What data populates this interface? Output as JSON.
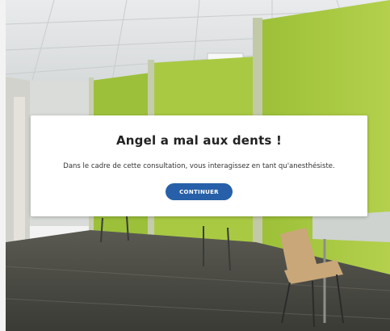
{
  "modal": {
    "title": "Angel a mal aux dents !",
    "text": "Dans le cadre de cette consultation, vous interagissez en tant qu'anesthésiste.",
    "button_label": "CONTINUER"
  },
  "colors": {
    "button": "#2760a8",
    "wall_green": "#a6c83c",
    "floor": "#4a4a44"
  }
}
